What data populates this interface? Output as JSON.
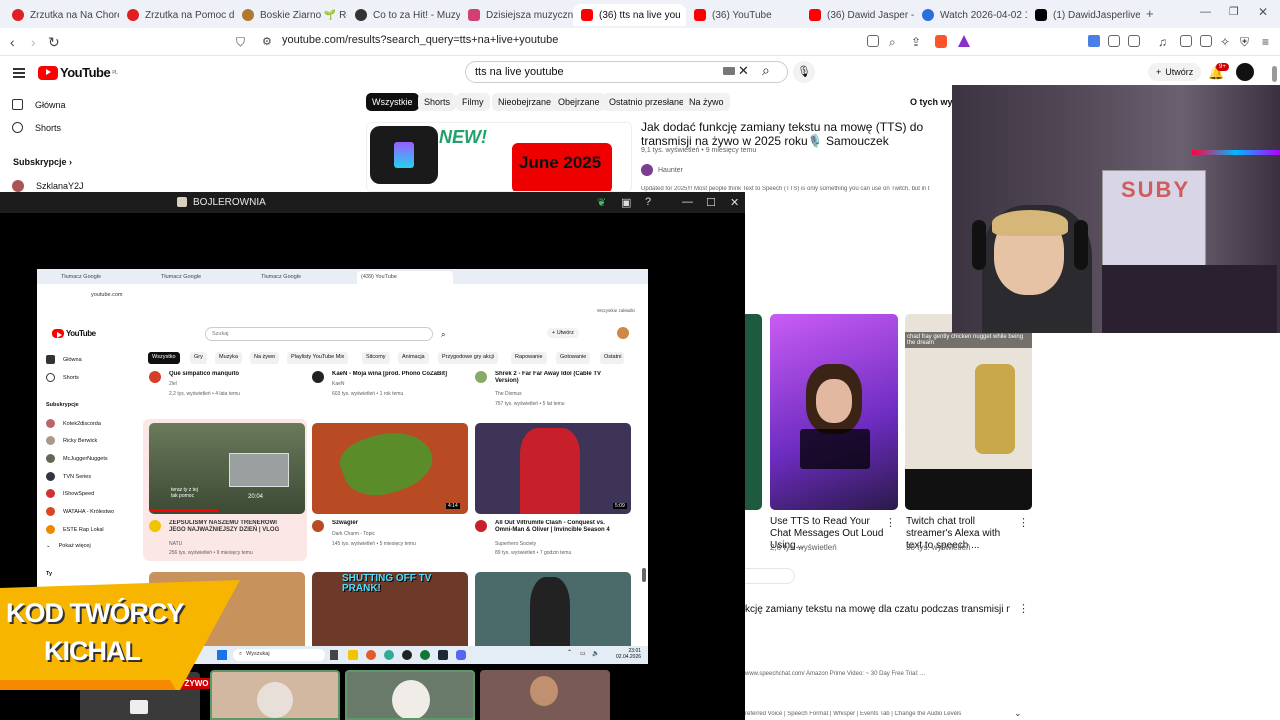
{
  "browser": {
    "tabs": [
      {
        "label": "Zrzutka na Na Chore O",
        "icon": "red-circle-icon"
      },
      {
        "label": "Zrzutka na Pomoc dla",
        "icon": "red-circle-icon"
      },
      {
        "label": "Boskie Ziarno 🌱 Reko",
        "icon": "coffee-icon"
      },
      {
        "label": "Co to za Hit! - Muzyczn",
        "icon": "dark-circle-icon"
      },
      {
        "label": "Dzisiejsza muzyczna k",
        "icon": "music-icon"
      },
      {
        "label": "(36) tts na live you",
        "icon": "youtube-icon",
        "active": true
      },
      {
        "label": "(36) YouTube",
        "icon": "youtube-icon"
      },
      {
        "label": "(36) Dawid Jasper - Og",
        "icon": "youtube-icon"
      },
      {
        "label": "Watch 2026-04-02 18",
        "icon": "blue-circle-icon"
      },
      {
        "label": "(1) DawidJasperlive (@",
        "icon": "x-icon"
      }
    ],
    "url": "youtube.com/results?search_query=tts+na+live+youtube"
  },
  "youtube": {
    "logo_text": "YouTube",
    "logo_region": "PL",
    "search_value": "tts na live youtube",
    "create_label": "Utwórz",
    "notif_badge": "9+",
    "sidebar": [
      {
        "label": "Główna",
        "icon": "home-icon"
      },
      {
        "label": "Shorts",
        "icon": "shorts-icon"
      }
    ],
    "subs_header": "Subskrypcje",
    "subs_first": "SzklanaY2J",
    "chips": [
      "Wszystkie",
      "Shorts",
      "Filmy",
      "Nieobejrzane",
      "Obejrzane",
      "Ostatnio przesłane",
      "Na żywo"
    ],
    "chips_right": "O tych wynik",
    "result1": {
      "thumb_new": "NEW!",
      "thumb_date": "June 2025",
      "title": "Jak dodać funkcję zamiany tekstu na mowę (TTS) do transmisji na żywo w 2025 roku🎙️ Samouczek Speaker.Bot",
      "meta": "9,1 tys. wyświetleń • 9 miesięcy temu",
      "channel": "Haunter",
      "desc": "Updated for 2025!!! Most people think Text to Speech (TTS) is only something you can use on Twitch, but in t"
    },
    "shorts_cards": [
      {
        "title": "Use TTS to Read Your Chat Messages Out Loud Using...",
        "views": "2,6 tys. wyświetleń"
      },
      {
        "title": "Twitch chat troll streamer's Alexa with text to speech ...",
        "views": "38 tys. wyświetleń",
        "caption": "chad fray gently chicken nugget while being the dream"
      }
    ],
    "result2_title": "kcję zamiany tekstu na mowę dla czatu podczas transmisji na",
    "result2_desc": "www.speechchat.com/ Amazon Prime Video: ~ 30 Day Free Trial: ...",
    "result2_chapters": "referred Voice | Speech Format | Whisper | Events Tab | Change the Audio Levels"
  },
  "overlay": {
    "title": "BOJLEROWNIA",
    "inner": {
      "tabs": [
        "Tłumacz Google",
        "Tłumacz Google",
        "Tłumacz Google",
        "(439) YouTube"
      ],
      "url": "youtube.com",
      "bookmarks": "Wszystkie zakładki",
      "search_placeholder": "Szukaj",
      "create_label": "Utwórz",
      "sidebar": [
        "Główna",
        "Shorts"
      ],
      "subs_header": "Subskrypcje",
      "subs": [
        "Kotek2discorda",
        "Ricky Berwick",
        "McJuggerNuggets",
        "TVN Series",
        "IShowSpeed",
        "WATAHA - Królestwo",
        "ESTE Rap Lokal",
        "Pokaż więcej"
      ],
      "you_label": "Ty",
      "chips": [
        "Wszystko",
        "Gry",
        "Muzyka",
        "Na żywo",
        "Playlisty YouTube Mix",
        "Sitcomy",
        "Animacja",
        "Przygodowe gry akcji",
        "Rapowanie",
        "Gotowanie",
        "Ostatni"
      ],
      "row1": [
        {
          "title": "Qué simpático manquito",
          "channel": "2lel",
          "meta": "2,2 tys. wyświetleń • 4 lata temu"
        },
        {
          "title": "KaeN - Moja wina [prod. Phono CoZaBit]",
          "channel": "KaeN",
          "meta": "603 tys. wyświetleń • 1 rok temu"
        },
        {
          "title": "Shrek 2 - Far Far Away Idol (Cable TV Version)",
          "channel": "The Dixmus",
          "meta": "757 tys. wyświetleń • 5 lat temu"
        }
      ],
      "row2": [
        {
          "title": "ZEPSULIŚMY NASZEMU TRENEROWI JEGO NAJWAŻNIEJSZY DZIEŃ | VLOG",
          "channel": "NATU",
          "meta": "256 tys. wyświetleń • 9 miesięcy temu",
          "duration": "20:04",
          "overlay": "teraz ty z tej tak pomoc"
        },
        {
          "title": "Szwagier",
          "channel": "Dark Charm - Topic",
          "meta": "145 tys. wyświetleń • 5 miesięcy temu",
          "duration": ""
        },
        {
          "title": "All Out Viltrumite Clash - Conquest vs. Omni-Man & Oliver | Invincible Season 4",
          "channel": "Superhero Society",
          "meta": "89 tys. wyświetleń • 7 godzin temu",
          "duration": "5:09"
        }
      ],
      "row2_mid_duration": "4:14",
      "row3_thumb_text": "SHUTTING OFF TV PRANK!",
      "taskbar_search": "Wyszukaj",
      "clock_time": "23:01",
      "clock_date": "02.04.2026"
    }
  },
  "banner": {
    "line1": "KOD TWÓRCY",
    "line2": "KICHAL"
  },
  "bottom_live_badge": "NA ŻYWO",
  "webcam": {
    "board_text": "SUBY"
  },
  "colors": {
    "yt_red": "#ff0000",
    "banner_yellow": "#f7b500",
    "banner_text": "#ffffff"
  }
}
